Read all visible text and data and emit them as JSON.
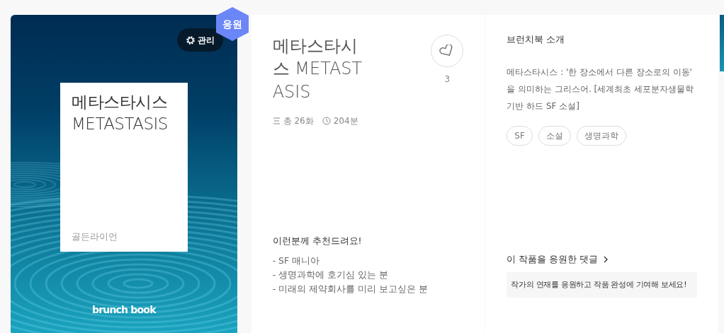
{
  "cover": {
    "title": "메타스타시스 METASTASIS",
    "author": "골든라이언",
    "brand": "brunch book",
    "manage_button": "관리",
    "badge": "응원"
  },
  "info": {
    "title": "메타스타시스 METASTASIS",
    "like_count": "3",
    "episodes": "총 26화",
    "duration": "204분",
    "recommend_heading": "이런분께 추천드려요!",
    "recommend_items": [
      "- SF 매니아",
      "- 생명과학에 호기심 있는 분",
      "- 미래의 제약회사를 미리 보고싶은 분"
    ]
  },
  "intro": {
    "heading": "브런치북 소개",
    "description": "메타스타시스 : '한 장소에서 다른 장소로의 이동' 을 의미하는 그리스어.  [세계최초 세포분자생물학 기반 하드 SF 소설]",
    "tags": [
      "SF",
      "소설",
      "생명과학"
    ],
    "comments_link": "이 작품을 응원한 댓글",
    "comments_prompt": "작가의 연재를 응원하고 작품 완성에 기여해 보세요!"
  }
}
